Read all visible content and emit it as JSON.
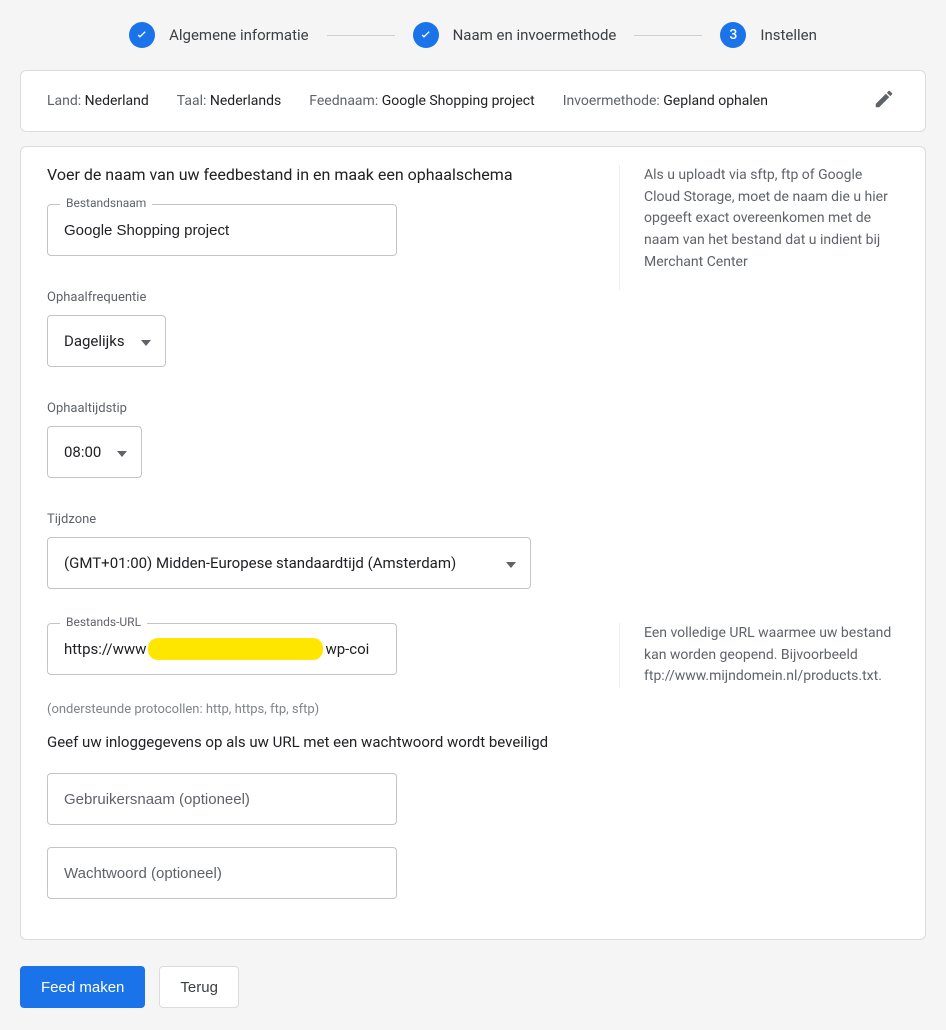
{
  "stepper": {
    "steps": [
      {
        "label": "Algemene informatie",
        "state": "done"
      },
      {
        "label": "Naam en invoermethode",
        "state": "done"
      },
      {
        "label": "Instellen",
        "state": "current",
        "number": "3"
      }
    ]
  },
  "summary": {
    "country_label": "Land:",
    "country_value": "Nederland",
    "language_label": "Taal:",
    "language_value": "Nederlands",
    "feedname_label": "Feednaam:",
    "feedname_value": "Google Shopping project",
    "method_label": "Invoermethode:",
    "method_value": "Gepland ophalen"
  },
  "form": {
    "heading": "Voer de naam van uw feedbestand in en maak een ophaalschema",
    "filename_label": "Bestandsnaam",
    "filename_value": "Google Shopping project",
    "aside_upload": "Als u uploadt via sftp, ftp of Google Cloud Storage, moet de naam die u hier opgeeft exact overeenkomen met de naam van het bestand dat u indient bij Merchant Center",
    "frequency_label": "Ophaalfrequentie",
    "frequency_value": "Dagelijks",
    "time_label": "Ophaaltijdstip",
    "time_value": "08:00",
    "timezone_label": "Tijdzone",
    "timezone_value": "(GMT+01:00) Midden-Europese standaardtijd (Amsterdam)",
    "url_label": "Bestands-URL",
    "url_left": "https://www",
    "url_right": "wp-coi",
    "aside_url": "Een volledige URL waarmee uw bestand kan worden geopend. Bijvoorbeeld ftp://www.mijndomein.nl/products.txt.",
    "protocols_hint": "(ondersteunde protocollen: http, https, ftp, sftp)",
    "credentials_heading": "Geef uw inloggegevens op als uw URL met een wachtwoord wordt beveiligd",
    "username_placeholder": "Gebruikersnaam (optioneel)",
    "password_placeholder": "Wachtwoord (optioneel)"
  },
  "footer": {
    "primary": "Feed maken",
    "secondary": "Terug"
  }
}
